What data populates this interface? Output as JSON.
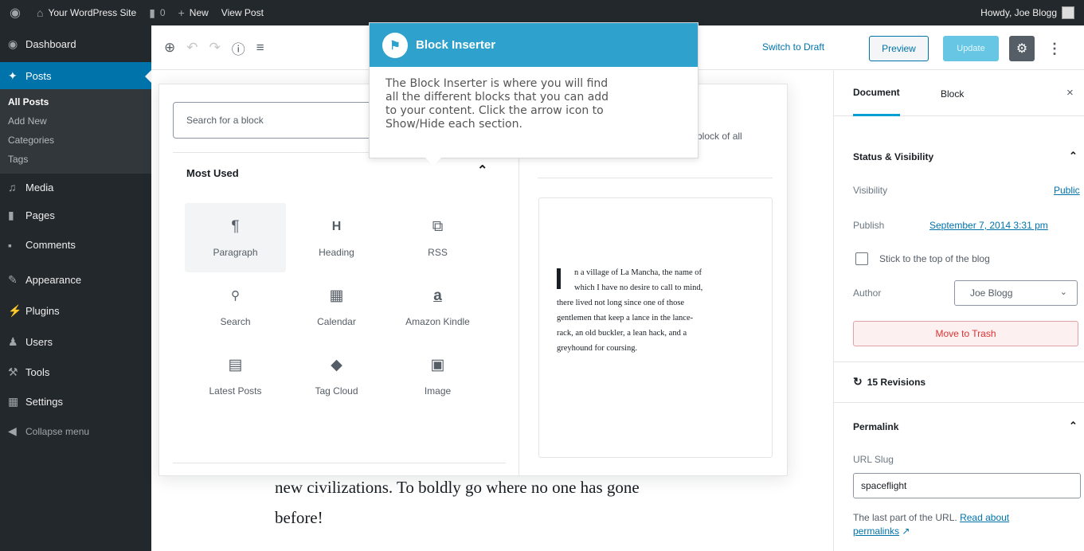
{
  "admin_bar": {
    "site_name": "Your WordPress Site",
    "comments_count": "0",
    "new_label": "New",
    "view_post_label": "View Post",
    "howdy": "Howdy, Joe Blogg"
  },
  "sidebar": {
    "items": [
      {
        "label": "Dashboard",
        "icon": "dashboard-icon"
      },
      {
        "label": "Posts",
        "icon": "pin-icon"
      },
      {
        "label": "Media",
        "icon": "media-icon"
      },
      {
        "label": "Pages",
        "icon": "pages-icon"
      },
      {
        "label": "Comments",
        "icon": "comments-icon"
      },
      {
        "label": "Appearance",
        "icon": "brush-icon"
      },
      {
        "label": "Plugins",
        "icon": "plugin-icon"
      },
      {
        "label": "Users",
        "icon": "users-icon"
      },
      {
        "label": "Tools",
        "icon": "wrench-icon"
      },
      {
        "label": "Settings",
        "icon": "settings-icon"
      }
    ],
    "posts_submenu": [
      "All Posts",
      "Add New",
      "Categories",
      "Tags"
    ],
    "collapse_label": "Collapse menu"
  },
  "toolbar": {
    "switch_to_draft": "Switch to Draft",
    "preview": "Preview",
    "update": "Update"
  },
  "inserter": {
    "search_placeholder": "Search for a block",
    "section_title": "Most Used",
    "blocks": [
      {
        "label": "Paragraph",
        "icon": "paragraph-icon"
      },
      {
        "label": "Heading",
        "icon": "heading-icon"
      },
      {
        "label": "RSS",
        "icon": "rss-icon"
      },
      {
        "label": "Search",
        "icon": "search-icon"
      },
      {
        "label": "Calendar",
        "icon": "calendar-icon"
      },
      {
        "label": "Amazon Kindle",
        "icon": "amazon-icon"
      },
      {
        "label": "Latest Posts",
        "icon": "list-icon"
      },
      {
        "label": "Tag Cloud",
        "icon": "tag-icon"
      },
      {
        "label": "Image",
        "icon": "image-icon"
      }
    ],
    "preview_description": "block of all",
    "preview_lines": [
      "n a village of La Mancha, the name of",
      "which I have no desire to call to mind,",
      "there lived not long since one of those",
      "gentlemen that keep a lance in the lance-",
      "rack, an old buckler, a lean hack, and a",
      "greyhound for coursing."
    ]
  },
  "tooltip": {
    "title": "Block Inserter",
    "lines": [
      "The Block Inserter is where you will find",
      "all the different blocks that you can add",
      "to your content. Click the arrow icon to",
      "Show/Hide each section."
    ]
  },
  "content": {
    "line1": "new civilizations. To boldly go where no one has gone",
    "line2": "before!"
  },
  "settings": {
    "tab_document": "Document",
    "tab_block": "Block",
    "status_title": "Status & Visibility",
    "visibility_label": "Visibility",
    "visibility_value": "Public",
    "publish_label": "Publish",
    "publish_value": "September 7, 2014 3:31 pm",
    "sticky_label": "Stick to the top of the blog",
    "author_label": "Author",
    "author_value": "Joe Blogg",
    "trash_label": "Move to Trash",
    "revisions_label": "15 Revisions",
    "permalink_title": "Permalink",
    "url_slug_label": "URL Slug",
    "slug_value": "spaceflight",
    "help_text": "The last part of the URL.",
    "help_link": "Read about",
    "help_link2": "permalinks"
  },
  "colors": {
    "admin_dark": "#23282d",
    "accent_blue": "#0073aa",
    "tooltip_blue": "#2ea2cc",
    "trash_red": "#dc3232"
  }
}
